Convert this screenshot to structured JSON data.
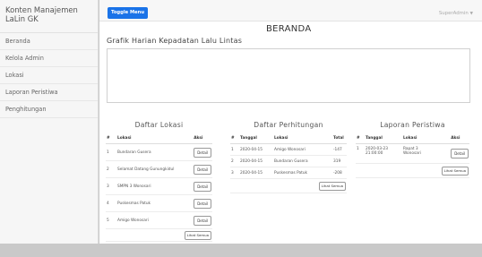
{
  "sidebar": {
    "brand_line1": "Konten Manajemen",
    "brand_line2": "LaLin GK",
    "items": [
      {
        "label": "Beranda"
      },
      {
        "label": "Kelola Admin"
      },
      {
        "label": "Lokasi"
      },
      {
        "label": "Laporan Peristiwa"
      },
      {
        "label": "Penghitungan"
      }
    ]
  },
  "topbar": {
    "toggle_label": "Toggle Menu",
    "user_label": "SuperAdmin",
    "caret": "▼"
  },
  "page_title": "BERANDA",
  "chart_section_title": "Grafik Harian Kepadatan Lalu Lintas",
  "lokasi": {
    "title": "Daftar Lokasi",
    "headers": [
      "#",
      "Lokasi",
      "Aksi"
    ],
    "rows": [
      {
        "no": "1",
        "name": "Bundaran Gusera"
      },
      {
        "no": "2",
        "name": "Selamat Datang Gunungkidul"
      },
      {
        "no": "3",
        "name": "SMPN 3 Wonosari"
      },
      {
        "no": "4",
        "name": "Puskesmas Patuk"
      },
      {
        "no": "5",
        "name": "Amigo Wonosari"
      }
    ],
    "detail_label": "Detail",
    "all_label": "Lihat Semua"
  },
  "perhitungan": {
    "title": "Daftar Perhitungan",
    "headers": [
      "#",
      "Tanggal",
      "Lokasi",
      "Total"
    ],
    "rows": [
      {
        "no": "1",
        "date": "2020-04-15",
        "loc": "Amigo Wonosari",
        "total": "-147"
      },
      {
        "no": "2",
        "date": "2020-04-15",
        "loc": "Bundaran Gusera",
        "total": "319"
      },
      {
        "no": "3",
        "date": "2020-04-15",
        "loc": "Puskesmas Patuk",
        "total": "-208"
      }
    ],
    "all_label": "Lihat Semua"
  },
  "laporan": {
    "title": "Laporan Peristiwa",
    "headers": [
      "#",
      "Tanggal",
      "Lokasi",
      "Aksi"
    ],
    "rows": [
      {
        "no": "1",
        "date": "2020-03-23",
        "time": "21:00:00",
        "loc1": "Rapat 3",
        "loc2": "Wonosari"
      }
    ],
    "detail_label": "Detail",
    "all_label": "Lihat Semua"
  }
}
